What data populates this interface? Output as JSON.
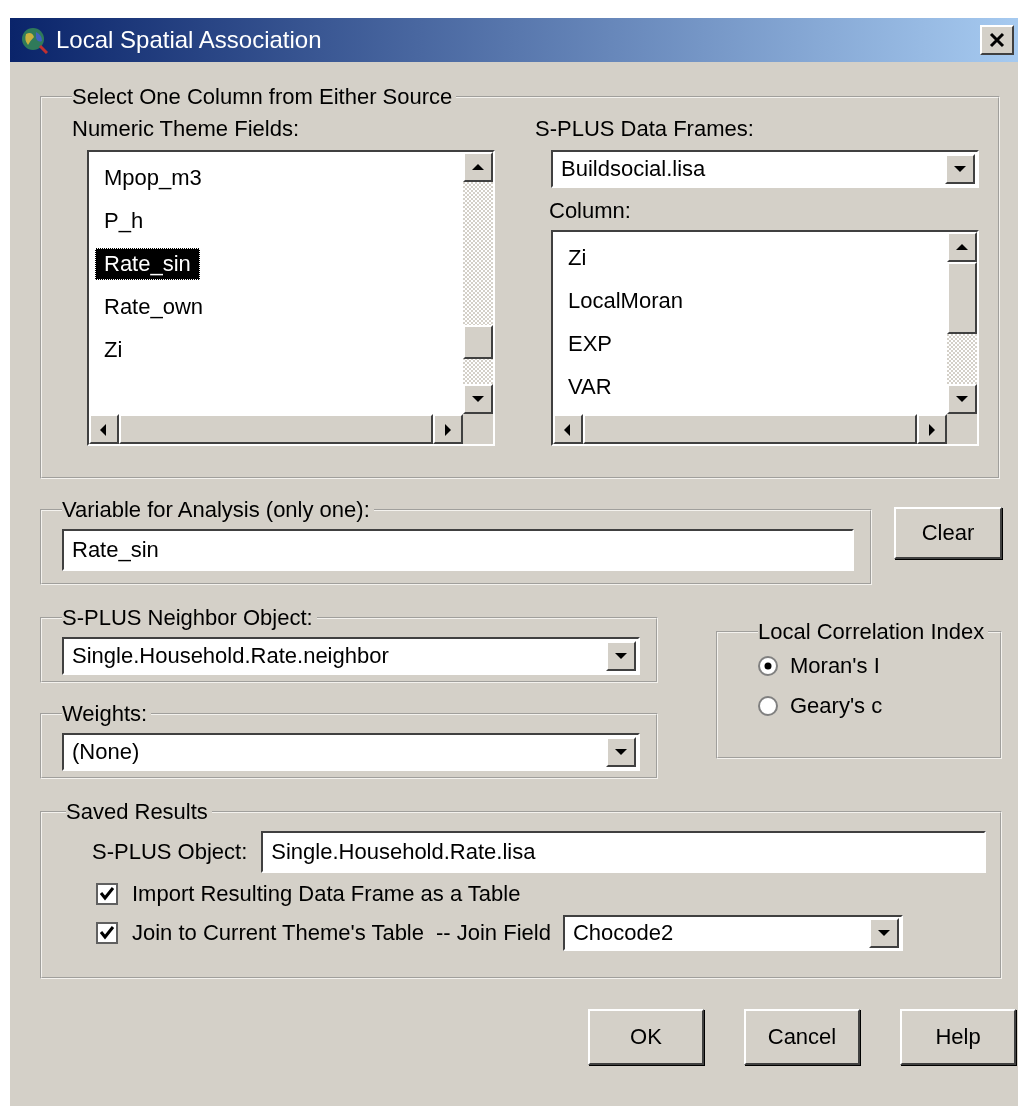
{
  "window": {
    "title": "Local Spatial Association"
  },
  "source_group": {
    "title": "Select One Column from Either Source",
    "theme_fields": {
      "label": "Numeric Theme Fields:",
      "items": [
        {
          "label": "Mpop_m3",
          "selected": false
        },
        {
          "label": "P_h",
          "selected": false
        },
        {
          "label": "Rate_sin",
          "selected": true
        },
        {
          "label": "Rate_own",
          "selected": false
        },
        {
          "label": "Zi",
          "selected": false
        }
      ]
    },
    "data_frames": {
      "label": "S-PLUS Data Frames:",
      "value": "Buildsocial.lisa"
    },
    "column": {
      "label": "Column:",
      "items": [
        {
          "label": "Zi",
          "selected": false
        },
        {
          "label": "LocalMoran",
          "selected": false
        },
        {
          "label": "EXP",
          "selected": false
        },
        {
          "label": "VAR",
          "selected": false
        }
      ]
    }
  },
  "variable": {
    "title": "Variable for Analysis (only one):",
    "value": "Rate_sin"
  },
  "clear_button": "Clear",
  "neighbor": {
    "title": "S-PLUS Neighbor Object:",
    "value": "Single.Household.Rate.neighbor"
  },
  "weights": {
    "title": "Weights:",
    "value": "(None)"
  },
  "correlation": {
    "title": "Local Correlation Index",
    "options": [
      {
        "label": "Moran's I",
        "selected": true
      },
      {
        "label": "Geary's c",
        "selected": false
      }
    ]
  },
  "saved": {
    "title": "Saved Results",
    "object_label": "S-PLUS Object:",
    "object_value": "Single.Household.Rate.lisa",
    "import": {
      "label": "Import Resulting Data Frame as a Table",
      "checked": true
    },
    "join": {
      "label": "Join to Current Theme's Table",
      "checked": true
    },
    "join_field_label": "-- Join Field",
    "join_field": "Chocode2"
  },
  "buttons": [
    "OK",
    "Cancel",
    "Help"
  ]
}
